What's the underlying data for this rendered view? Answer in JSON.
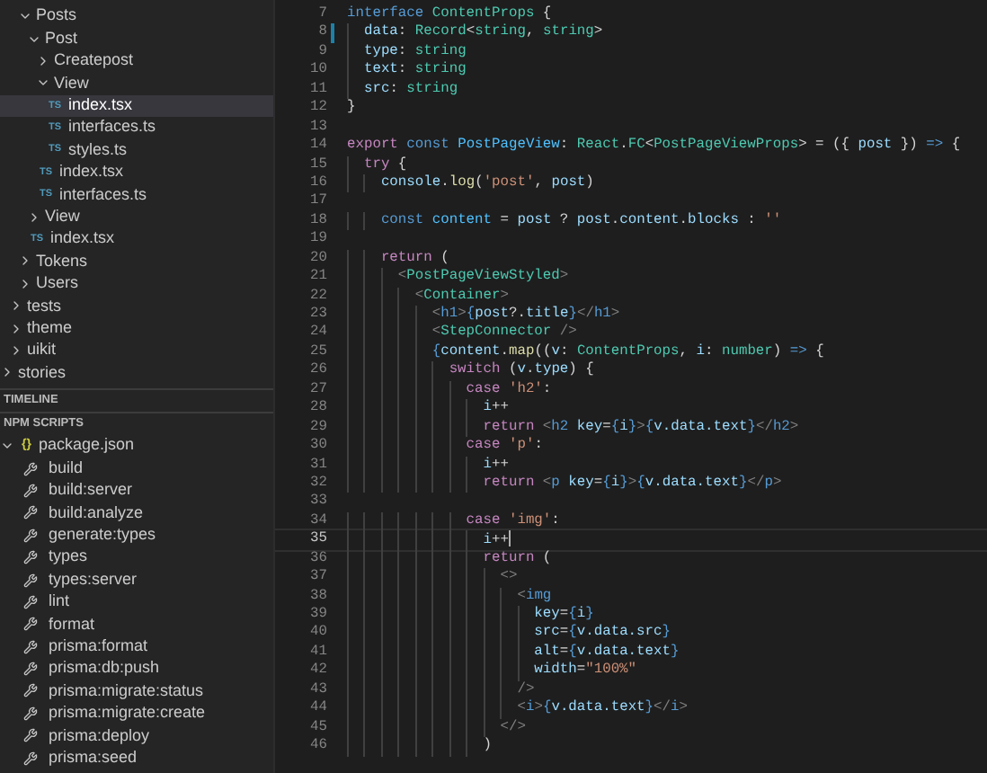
{
  "explorer": {
    "tree": [
      {
        "children": [
          {
            "children": [
              {
                "label": "Posts",
                "kind": "folder",
                "expanded": true,
                "selected": false,
                "children": [
                  {
                    "label": "Post",
                    "kind": "folder",
                    "expanded": true,
                    "selected": false,
                    "children": [
                      {
                        "label": "Createpost",
                        "kind": "folder",
                        "expanded": false,
                        "selected": false
                      },
                      {
                        "label": "View",
                        "kind": "folder",
                        "expanded": true,
                        "selected": false,
                        "children": [
                          {
                            "label": "index.tsx",
                            "kind": "file",
                            "icon": "TS",
                            "selected": true
                          },
                          {
                            "label": "interfaces.ts",
                            "kind": "file",
                            "icon": "TS",
                            "selected": false
                          },
                          {
                            "label": "styles.ts",
                            "kind": "file",
                            "icon": "TS",
                            "selected": false
                          }
                        ]
                      },
                      {
                        "label": "index.tsx",
                        "kind": "file",
                        "icon": "TS",
                        "selected": false
                      },
                      {
                        "label": "interfaces.ts",
                        "kind": "file",
                        "icon": "TS",
                        "selected": false
                      }
                    ]
                  },
                  {
                    "label": "View",
                    "kind": "folder",
                    "expanded": false,
                    "selected": false
                  },
                  {
                    "label": "index.tsx",
                    "kind": "file",
                    "icon": "TS",
                    "selected": false
                  }
                ]
              },
              {
                "label": "Tokens",
                "kind": "folder",
                "expanded": false,
                "selected": false
              },
              {
                "label": "Users",
                "kind": "folder",
                "expanded": false,
                "selected": false
              }
            ]
          },
          {
            "label": "tests",
            "kind": "folder",
            "expanded": false,
            "selected": false
          },
          {
            "label": "theme",
            "kind": "folder",
            "expanded": false,
            "selected": false
          },
          {
            "label": "uikit",
            "kind": "folder",
            "expanded": false,
            "selected": false
          }
        ]
      },
      {
        "label": "stories",
        "kind": "folder",
        "expanded": false,
        "selected": false
      }
    ]
  },
  "timeline": {
    "title": "TIMELINE"
  },
  "npm_scripts": {
    "title": "NPM SCRIPTS",
    "package": {
      "label": "package.json",
      "icon": "{}",
      "expanded": true
    },
    "scripts": [
      "build",
      "build:server",
      "build:analyze",
      "generate:types",
      "types",
      "types:server",
      "lint",
      "format",
      "prisma:format",
      "prisma:db:push",
      "prisma:migrate:status",
      "prisma:migrate:create",
      "prisma:deploy",
      "prisma:seed"
    ]
  },
  "editor": {
    "lines": [
      {
        "n": "7",
        "current": false,
        "modified": false,
        "tokens": [
          {
            "text": "interface ",
            "kind": "k"
          },
          {
            "text": "ContentProps",
            "kind": "t"
          },
          {
            "text": " {",
            "kind": "p"
          }
        ]
      },
      {
        "n": "8",
        "current": false,
        "modified": true,
        "tokens": [
          {
            "text": "  data",
            "kind": "v"
          },
          {
            "text": ": ",
            "kind": "p"
          },
          {
            "text": "Record",
            "kind": "t"
          },
          {
            "text": "<",
            "kind": "p"
          },
          {
            "text": "string",
            "kind": "t"
          },
          {
            "text": ", ",
            "kind": "p"
          },
          {
            "text": "string",
            "kind": "t"
          },
          {
            "text": ">",
            "kind": "p"
          }
        ]
      },
      {
        "n": "9",
        "current": false,
        "modified": false,
        "tokens": [
          {
            "text": "  type",
            "kind": "v"
          },
          {
            "text": ": ",
            "kind": "p"
          },
          {
            "text": "string",
            "kind": "t"
          }
        ]
      },
      {
        "n": "10",
        "current": false,
        "modified": false,
        "tokens": [
          {
            "text": "  text",
            "kind": "v"
          },
          {
            "text": ": ",
            "kind": "p"
          },
          {
            "text": "string",
            "kind": "t"
          }
        ]
      },
      {
        "n": "11",
        "current": false,
        "modified": false,
        "tokens": [
          {
            "text": "  src",
            "kind": "v"
          },
          {
            "text": ": ",
            "kind": "p"
          },
          {
            "text": "string",
            "kind": "t"
          }
        ]
      },
      {
        "n": "12",
        "current": false,
        "modified": false,
        "tokens": [
          {
            "text": "}",
            "kind": "p"
          }
        ]
      },
      {
        "n": "13",
        "current": false,
        "modified": false
      },
      {
        "n": "14",
        "current": false,
        "modified": false,
        "tokens": [
          {
            "text": "export ",
            "kind": "c"
          },
          {
            "text": "const ",
            "kind": "k"
          },
          {
            "text": "PostPageView",
            "kind": "n"
          },
          {
            "text": ": ",
            "kind": "p"
          },
          {
            "text": "React",
            "kind": "t"
          },
          {
            "text": ".",
            "kind": "p"
          },
          {
            "text": "FC",
            "kind": "t"
          },
          {
            "text": "<",
            "kind": "p"
          },
          {
            "text": "PostPageViewProps",
            "kind": "t"
          },
          {
            "text": "> = ({ ",
            "kind": "p"
          },
          {
            "text": "post",
            "kind": "v"
          },
          {
            "text": " }) ",
            "kind": "p"
          },
          {
            "text": "=>",
            "kind": "k"
          },
          {
            "text": " {",
            "kind": "p"
          }
        ]
      },
      {
        "n": "15",
        "current": false,
        "modified": false,
        "tokens": [
          {
            "text": "  try",
            "kind": "c"
          },
          {
            "text": " {",
            "kind": "p"
          }
        ]
      },
      {
        "n": "16",
        "current": false,
        "modified": false,
        "tokens": [
          {
            "text": "    console",
            "kind": "v"
          },
          {
            "text": ".",
            "kind": "p"
          },
          {
            "text": "log",
            "kind": "f"
          },
          {
            "text": "(",
            "kind": "p"
          },
          {
            "text": "'post'",
            "kind": "s"
          },
          {
            "text": ", ",
            "kind": "p"
          },
          {
            "text": "post",
            "kind": "v"
          },
          {
            "text": ")",
            "kind": "p"
          }
        ]
      },
      {
        "n": "17",
        "current": false,
        "modified": false
      },
      {
        "n": "18",
        "current": false,
        "modified": false,
        "tokens": [
          {
            "text": "    const ",
            "kind": "k"
          },
          {
            "text": "content",
            "kind": "n"
          },
          {
            "text": " = ",
            "kind": "p"
          },
          {
            "text": "post",
            "kind": "v"
          },
          {
            "text": " ? ",
            "kind": "p"
          },
          {
            "text": "post",
            "kind": "v"
          },
          {
            "text": ".",
            "kind": "p"
          },
          {
            "text": "content",
            "kind": "v"
          },
          {
            "text": ".",
            "kind": "p"
          },
          {
            "text": "blocks",
            "kind": "v"
          },
          {
            "text": " : ",
            "kind": "p"
          },
          {
            "text": "''",
            "kind": "s"
          }
        ]
      },
      {
        "n": "19",
        "current": false,
        "modified": false
      },
      {
        "n": "20",
        "current": false,
        "modified": false,
        "tokens": [
          {
            "text": "    return",
            "kind": "c"
          },
          {
            "text": " (",
            "kind": "p"
          }
        ]
      },
      {
        "n": "21",
        "current": false,
        "modified": false,
        "tokens": [
          {
            "text": "      <",
            "kind": "g"
          },
          {
            "text": "PostPageViewStyled",
            "kind": "t"
          },
          {
            "text": ">",
            "kind": "g"
          }
        ]
      },
      {
        "n": "22",
        "current": false,
        "modified": false,
        "tokens": [
          {
            "text": "        <",
            "kind": "g"
          },
          {
            "text": "Container",
            "kind": "t"
          },
          {
            "text": ">",
            "kind": "g"
          }
        ]
      },
      {
        "n": "23",
        "current": false,
        "modified": false,
        "tokens": [
          {
            "text": "          <",
            "kind": "g"
          },
          {
            "text": "h1",
            "kind": "k"
          },
          {
            "text": ">",
            "kind": "g"
          },
          {
            "text": "{",
            "kind": "k"
          },
          {
            "text": "post",
            "kind": "v"
          },
          {
            "text": "?.",
            "kind": "p"
          },
          {
            "text": "title",
            "kind": "v"
          },
          {
            "text": "}",
            "kind": "k"
          },
          {
            "text": "</",
            "kind": "g"
          },
          {
            "text": "h1",
            "kind": "k"
          },
          {
            "text": ">",
            "kind": "g"
          }
        ]
      },
      {
        "n": "24",
        "current": false,
        "modified": false,
        "tokens": [
          {
            "text": "          <",
            "kind": "g"
          },
          {
            "text": "StepConnector",
            "kind": "t"
          },
          {
            "text": " />",
            "kind": "g"
          }
        ]
      },
      {
        "n": "25",
        "current": false,
        "modified": false,
        "tokens": [
          {
            "text": "          {",
            "kind": "k"
          },
          {
            "text": "content",
            "kind": "v"
          },
          {
            "text": ".",
            "kind": "p"
          },
          {
            "text": "map",
            "kind": "f"
          },
          {
            "text": "((",
            "kind": "p"
          },
          {
            "text": "v",
            "kind": "v"
          },
          {
            "text": ": ",
            "kind": "p"
          },
          {
            "text": "ContentProps",
            "kind": "t"
          },
          {
            "text": ", ",
            "kind": "p"
          },
          {
            "text": "i",
            "kind": "v"
          },
          {
            "text": ": ",
            "kind": "p"
          },
          {
            "text": "number",
            "kind": "t"
          },
          {
            "text": ") ",
            "kind": "p"
          },
          {
            "text": "=>",
            "kind": "k"
          },
          {
            "text": " {",
            "kind": "p"
          }
        ]
      },
      {
        "n": "26",
        "current": false,
        "modified": false,
        "tokens": [
          {
            "text": "            switch",
            "kind": "c"
          },
          {
            "text": " (",
            "kind": "p"
          },
          {
            "text": "v",
            "kind": "v"
          },
          {
            "text": ".",
            "kind": "p"
          },
          {
            "text": "type",
            "kind": "v"
          },
          {
            "text": ") {",
            "kind": "p"
          }
        ]
      },
      {
        "n": "27",
        "current": false,
        "modified": false,
        "tokens": [
          {
            "text": "              case ",
            "kind": "c"
          },
          {
            "text": "'h2'",
            "kind": "s"
          },
          {
            "text": ":",
            "kind": "p"
          }
        ]
      },
      {
        "n": "28",
        "current": false,
        "modified": false,
        "tokens": [
          {
            "text": "                i",
            "kind": "v"
          },
          {
            "text": "++",
            "kind": "p"
          }
        ]
      },
      {
        "n": "29",
        "current": false,
        "modified": false,
        "tokens": [
          {
            "text": "                return ",
            "kind": "c"
          },
          {
            "text": "<",
            "kind": "g"
          },
          {
            "text": "h2 ",
            "kind": "k"
          },
          {
            "text": "key",
            "kind": "v"
          },
          {
            "text": "=",
            "kind": "p"
          },
          {
            "text": "{",
            "kind": "k"
          },
          {
            "text": "i",
            "kind": "v"
          },
          {
            "text": "}",
            "kind": "k"
          },
          {
            "text": ">",
            "kind": "g"
          },
          {
            "text": "{",
            "kind": "k"
          },
          {
            "text": "v.data.text",
            "kind": "v"
          },
          {
            "text": "}",
            "kind": "k"
          },
          {
            "text": "</",
            "kind": "g"
          },
          {
            "text": "h2",
            "kind": "k"
          },
          {
            "text": ">",
            "kind": "g"
          }
        ]
      },
      {
        "n": "30",
        "current": false,
        "modified": false,
        "tokens": [
          {
            "text": "              case ",
            "kind": "c"
          },
          {
            "text": "'p'",
            "kind": "s"
          },
          {
            "text": ":",
            "kind": "p"
          }
        ]
      },
      {
        "n": "31",
        "current": false,
        "modified": false,
        "tokens": [
          {
            "text": "                i",
            "kind": "v"
          },
          {
            "text": "++",
            "kind": "p"
          }
        ]
      },
      {
        "n": "32",
        "current": false,
        "modified": false,
        "tokens": [
          {
            "text": "                return ",
            "kind": "c"
          },
          {
            "text": "<",
            "kind": "g"
          },
          {
            "text": "p ",
            "kind": "k"
          },
          {
            "text": "key",
            "kind": "v"
          },
          {
            "text": "=",
            "kind": "p"
          },
          {
            "text": "{",
            "kind": "k"
          },
          {
            "text": "i",
            "kind": "v"
          },
          {
            "text": "}",
            "kind": "k"
          },
          {
            "text": ">",
            "kind": "g"
          },
          {
            "text": "{",
            "kind": "k"
          },
          {
            "text": "v.data.text",
            "kind": "v"
          },
          {
            "text": "}",
            "kind": "k"
          },
          {
            "text": "</",
            "kind": "g"
          },
          {
            "text": "p",
            "kind": "k"
          },
          {
            "text": ">",
            "kind": "g"
          }
        ]
      },
      {
        "n": "33",
        "current": false,
        "modified": false
      },
      {
        "n": "34",
        "current": false,
        "modified": false,
        "tokens": [
          {
            "text": "              case ",
            "kind": "c"
          },
          {
            "text": "'img'",
            "kind": "s"
          },
          {
            "text": ":",
            "kind": "p"
          }
        ]
      },
      {
        "n": "35",
        "current": true,
        "modified": false,
        "tokens": [
          {
            "text": "                i",
            "kind": "v"
          },
          {
            "text": "++",
            "kind": "p"
          }
        ]
      },
      {
        "n": "36",
        "current": false,
        "modified": false,
        "tokens": [
          {
            "text": "                return",
            "kind": "c"
          },
          {
            "text": " (",
            "kind": "p"
          }
        ]
      },
      {
        "n": "37",
        "current": false,
        "modified": false,
        "tokens": [
          {
            "text": "                  <>",
            "kind": "g"
          }
        ]
      },
      {
        "n": "38",
        "current": false,
        "modified": false,
        "tokens": [
          {
            "text": "                    <",
            "kind": "g"
          },
          {
            "text": "img",
            "kind": "k"
          }
        ]
      },
      {
        "n": "39",
        "current": false,
        "modified": false,
        "tokens": [
          {
            "text": "                      key",
            "kind": "v"
          },
          {
            "text": "=",
            "kind": "p"
          },
          {
            "text": "{",
            "kind": "k"
          },
          {
            "text": "i",
            "kind": "v"
          },
          {
            "text": "}",
            "kind": "k"
          }
        ]
      },
      {
        "n": "40",
        "current": false,
        "modified": false,
        "tokens": [
          {
            "text": "                      src",
            "kind": "v"
          },
          {
            "text": "=",
            "kind": "p"
          },
          {
            "text": "{",
            "kind": "k"
          },
          {
            "text": "v.data.src",
            "kind": "v"
          },
          {
            "text": "}",
            "kind": "k"
          }
        ]
      },
      {
        "n": "41",
        "current": false,
        "modified": false,
        "tokens": [
          {
            "text": "                      alt",
            "kind": "v"
          },
          {
            "text": "=",
            "kind": "p"
          },
          {
            "text": "{",
            "kind": "k"
          },
          {
            "text": "v.data.text",
            "kind": "v"
          },
          {
            "text": "}",
            "kind": "k"
          }
        ]
      },
      {
        "n": "42",
        "current": false,
        "modified": false,
        "tokens": [
          {
            "text": "                      width",
            "kind": "v"
          },
          {
            "text": "=",
            "kind": "p"
          },
          {
            "text": "\"100%\"",
            "kind": "s"
          }
        ]
      },
      {
        "n": "43",
        "current": false,
        "modified": false,
        "tokens": [
          {
            "text": "                    />",
            "kind": "g"
          }
        ]
      },
      {
        "n": "44",
        "current": false,
        "modified": false,
        "tokens": [
          {
            "text": "                    <",
            "kind": "g"
          },
          {
            "text": "i",
            "kind": "k"
          },
          {
            "text": ">",
            "kind": "g"
          },
          {
            "text": "{",
            "kind": "k"
          },
          {
            "text": "v.data.text",
            "kind": "v"
          },
          {
            "text": "}",
            "kind": "k"
          },
          {
            "text": "</",
            "kind": "g"
          },
          {
            "text": "i",
            "kind": "k"
          },
          {
            "text": ">",
            "kind": "g"
          }
        ]
      },
      {
        "n": "45",
        "current": false,
        "modified": false,
        "tokens": [
          {
            "text": "                  </>",
            "kind": "g"
          }
        ]
      },
      {
        "n": "46",
        "current": false,
        "modified": false,
        "tokens": [
          {
            "text": "                )",
            "kind": "p"
          }
        ]
      }
    ]
  }
}
